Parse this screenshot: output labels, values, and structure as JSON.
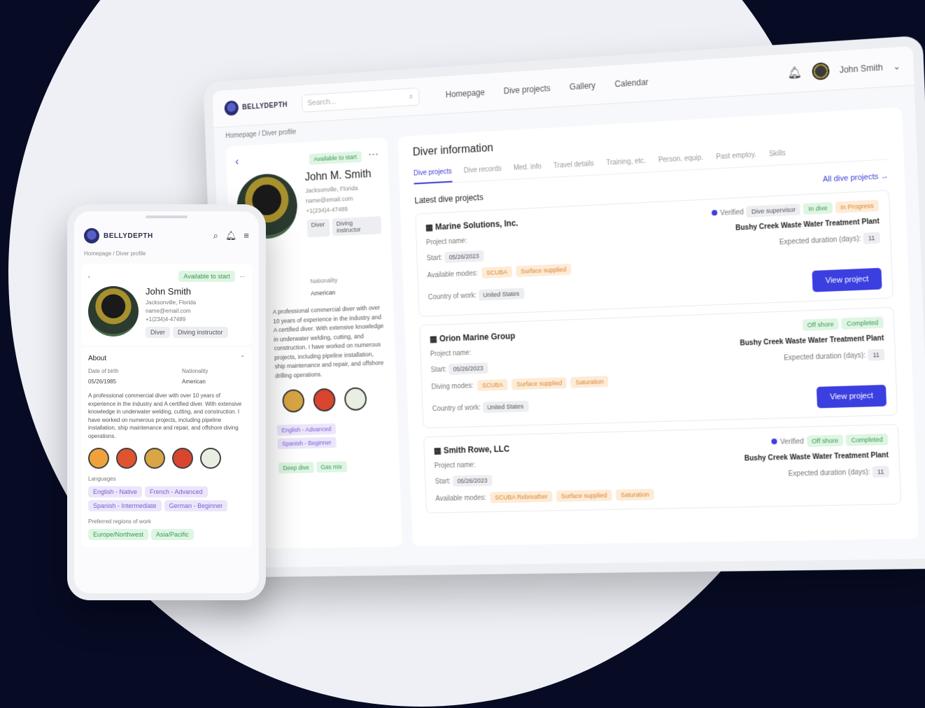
{
  "tablet": {
    "brand": "BELLYDEPTH",
    "search_placeholder": "Search...",
    "nav": [
      "Homepage",
      "Dive projects",
      "Gallery",
      "Calendar"
    ],
    "user_name": "John Smith",
    "breadcrumb": "Homepage  /  Diver profile",
    "profile": {
      "status": "Available to start",
      "name": "John M. Smith",
      "location": "Jacksonville, Florida",
      "email": "name@email.com",
      "phone": "+1(234)4-47489",
      "tags": [
        "Diver",
        "Diving instructor"
      ],
      "nationality_label": "Nationality",
      "nationality": "American",
      "about": "A professional commercial diver with over 10 years of experience in the industry and A certified diver. With extensive knowledge in underwater welding, cutting, and construction. I have worked on numerous projects, including pipeline installation, ship maintenance and repair, and offshore drilling operations.",
      "skill_tags": [
        "English - Advanced",
        "Spanish - Beginner",
        "Deep dive",
        "Gas mix"
      ]
    },
    "main": {
      "title": "Diver information",
      "tabs": [
        "Dive projects",
        "Dive records",
        "Med. info",
        "Travel details",
        "Training, etc.",
        "Person. equip.",
        "Past employ.",
        "Skills"
      ],
      "section_title": "Latest dive projects",
      "all_link": "All dive projects →",
      "cards": [
        {
          "company": "Marine Solutions, Inc.",
          "status_badges": [
            "Verified",
            "Dive supervisor",
            "In dive",
            "In Progress"
          ],
          "project_label": "Project name:",
          "project_name": "Bushy Creek Waste Water Treatment Plant",
          "start_label": "Start:",
          "start": "05/26/2023",
          "duration_label": "Expected duration (days):",
          "duration": "11",
          "modes_label": "Available modes:",
          "modes": [
            "SCUBA",
            "Surface supplied"
          ],
          "country_label": "Country of work:",
          "country": "United States",
          "button": "View project"
        },
        {
          "company": "Orion Marine Group",
          "status_badges": [
            "Off shore",
            "Completed"
          ],
          "project_label": "Project name:",
          "project_name": "Bushy Creek Waste Water Treatment Plant",
          "start_label": "Start:",
          "start": "05/26/2023",
          "duration_label": "Expected duration (days):",
          "duration": "11",
          "modes_label": "Diving modes:",
          "modes": [
            "SCUBA",
            "Surface supplied",
            "Saturation"
          ],
          "country_label": "Country of work:",
          "country": "United States",
          "button": "View project"
        },
        {
          "company": "Smith Rowe, LLC",
          "status_badges": [
            "Verified",
            "Off shore",
            "Completed"
          ],
          "project_label": "Project name:",
          "project_name": "Bushy Creek Waste Water Treatment Plant",
          "start_label": "Start:",
          "start": "05/26/2023",
          "duration_label": "Expected duration (days):",
          "duration": "11",
          "modes_label": "Available modes:",
          "modes": [
            "SCUBA Rebreather",
            "Surface supplied",
            "Saturation"
          ]
        }
      ]
    }
  },
  "phone": {
    "brand": "BELLYDEPTH",
    "breadcrumb": "Homepage  /  Diver profile",
    "status": "Available to start",
    "name": "John Smith",
    "location": "Jacksonville, Florida",
    "email": "name@email.com",
    "phone": "+1(234)4-47489",
    "tags": [
      "Diver",
      "Diving instructor"
    ],
    "about_title": "About",
    "dob_label": "Date of birth",
    "dob": "05/26/1985",
    "nationality_label": "Nationality",
    "nationality": "American",
    "about": "A professional commercial diver with over 10 years of experience in the industry and A certified diver. With extensive knowledge in underwater welding, cutting, and construction. I have worked on numerous projects, including pipeline installation, ship maintenance and repair, and offshore diving operations.",
    "languages_label": "Languages",
    "languages": [
      "English - Native",
      "French - Advanced",
      "Spanish - Intermediate",
      "German - Beginner"
    ],
    "regions_label": "Preferred regions of work",
    "regions": [
      "Europe/Northwest",
      "Asia/Pacific"
    ]
  }
}
